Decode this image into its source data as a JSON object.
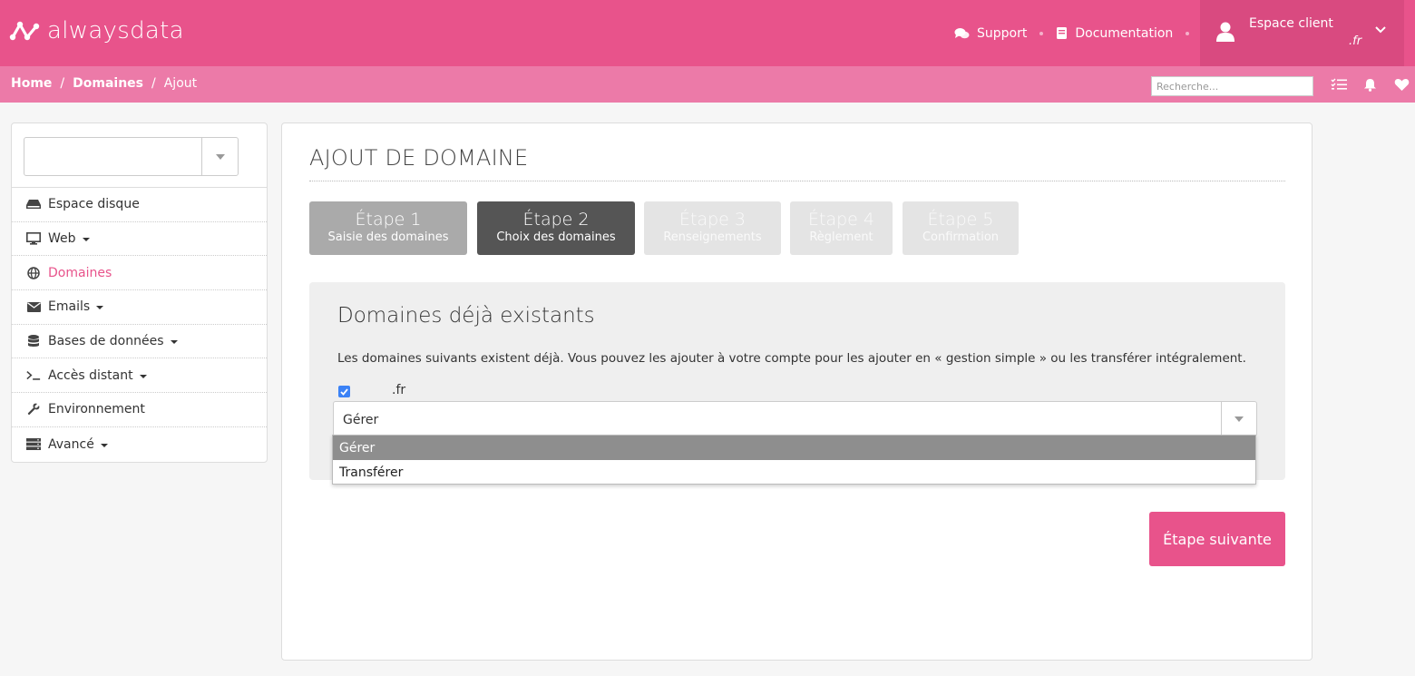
{
  "header": {
    "brand": "alwaysdata",
    "support_label": "Support",
    "docs_label": "Documentation",
    "account_label": "Espace client",
    "account_sub": ".fr"
  },
  "breadcrumb": {
    "home": "Home",
    "sep1": "/",
    "domains": "Domaines",
    "sep2": "/",
    "current": "Ajout"
  },
  "search": {
    "placeholder": "Recherche..."
  },
  "sidebar": {
    "items": [
      {
        "label": "Espace disque",
        "icon": "hdd-icon",
        "dropdown": false
      },
      {
        "label": "Web",
        "icon": "monitor-icon",
        "dropdown": true
      },
      {
        "label": "Domaines",
        "icon": "globe-icon",
        "dropdown": false,
        "active": true
      },
      {
        "label": "Emails",
        "icon": "envelope-icon",
        "dropdown": true
      },
      {
        "label": "Bases de données",
        "icon": "database-icon",
        "dropdown": true
      },
      {
        "label": "Accès distant",
        "icon": "terminal-icon",
        "dropdown": true
      },
      {
        "label": "Environnement",
        "icon": "wrench-icon",
        "dropdown": false
      },
      {
        "label": "Avancé",
        "icon": "server-icon",
        "dropdown": true
      }
    ]
  },
  "main": {
    "title": "AJOUT DE DOMAINE",
    "steps": [
      {
        "title": "Étape 1",
        "sub": "Saisie des domaines",
        "state": "done"
      },
      {
        "title": "Étape 2",
        "sub": "Choix des domaines",
        "state": "current"
      },
      {
        "title": "Étape 3",
        "sub": "Renseignements",
        "state": "todo"
      },
      {
        "title": "Étape 4",
        "sub": "Règlement",
        "state": "todo"
      },
      {
        "title": "Étape 5",
        "sub": "Confirmation",
        "state": "todo"
      }
    ],
    "existing": {
      "title": "Domaines déjà existants",
      "text": "Les domaines suivants existent déjà. Vous pouvez les ajouter à votre compte pour les ajouter en « gestion simple » ou les transférer intégralement.",
      "domain_label": ".fr",
      "checked": true,
      "select_value": "Gérer",
      "options": [
        "Gérer",
        "Transférer"
      ]
    },
    "next_label": "Étape suivante"
  },
  "colors": {
    "brand": "#e8538b",
    "brand_light": "#ec7aa8",
    "step_current": "#555555",
    "step_done": "#aaaaaa",
    "checkbox": "#3b82f6"
  }
}
